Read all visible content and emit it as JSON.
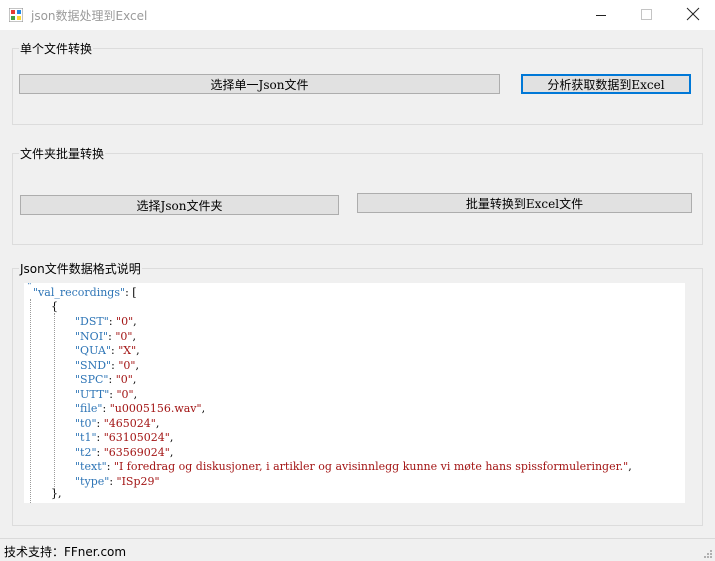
{
  "window": {
    "title": "json数据处理到Excel",
    "controls": [
      "minimize-icon",
      "maximize-icon",
      "close-icon"
    ]
  },
  "single_file": {
    "group_title": "单个文件转换",
    "select_label": "选择单一Json文件",
    "analyze_label": "分析获取数据到Excel"
  },
  "folder": {
    "group_title": "文件夹批量转换",
    "select_label": "选择Json文件夹",
    "batch_label": "批量转换到Excel文件"
  },
  "format": {
    "group_title": "Json文件数据格式说明",
    "root_key": "\"val_recordings\"",
    "fields": [
      {
        "key": "\"DST\"",
        "value": "\"0\"",
        "sep": ","
      },
      {
        "key": "\"NOI\"",
        "value": "\"0\"",
        "sep": ","
      },
      {
        "key": "\"QUA\"",
        "value": "\"X\"",
        "sep": ","
      },
      {
        "key": "\"SND\"",
        "value": "\"0\"",
        "sep": ","
      },
      {
        "key": "\"SPC\"",
        "value": "\"0\"",
        "sep": ","
      },
      {
        "key": "\"UTT\"",
        "value": "\"0\"",
        "sep": ","
      },
      {
        "key": "\"file\"",
        "value": "\"u0005156.wav\"",
        "sep": ","
      },
      {
        "key": "\"t0\"",
        "value": "\"465024\"",
        "sep": ","
      },
      {
        "key": "\"t1\"",
        "value": "\"63105024\"",
        "sep": ","
      },
      {
        "key": "\"t2\"",
        "value": "\"63569024\"",
        "sep": ","
      },
      {
        "key": "\"text\"",
        "value": "\"I foredrag og diskusjoner, i artikler og avisinnlegg kunne vi møte hans spissformuleringer.\"",
        "sep": ","
      },
      {
        "key": "\"type\"",
        "value": "\"ISp29\"",
        "sep": ""
      }
    ]
  },
  "status": {
    "text": "技术支持：FFner.com"
  },
  "colors": {
    "key": "#2e75b6",
    "string": "#a31515",
    "accent": "#0078d7"
  }
}
